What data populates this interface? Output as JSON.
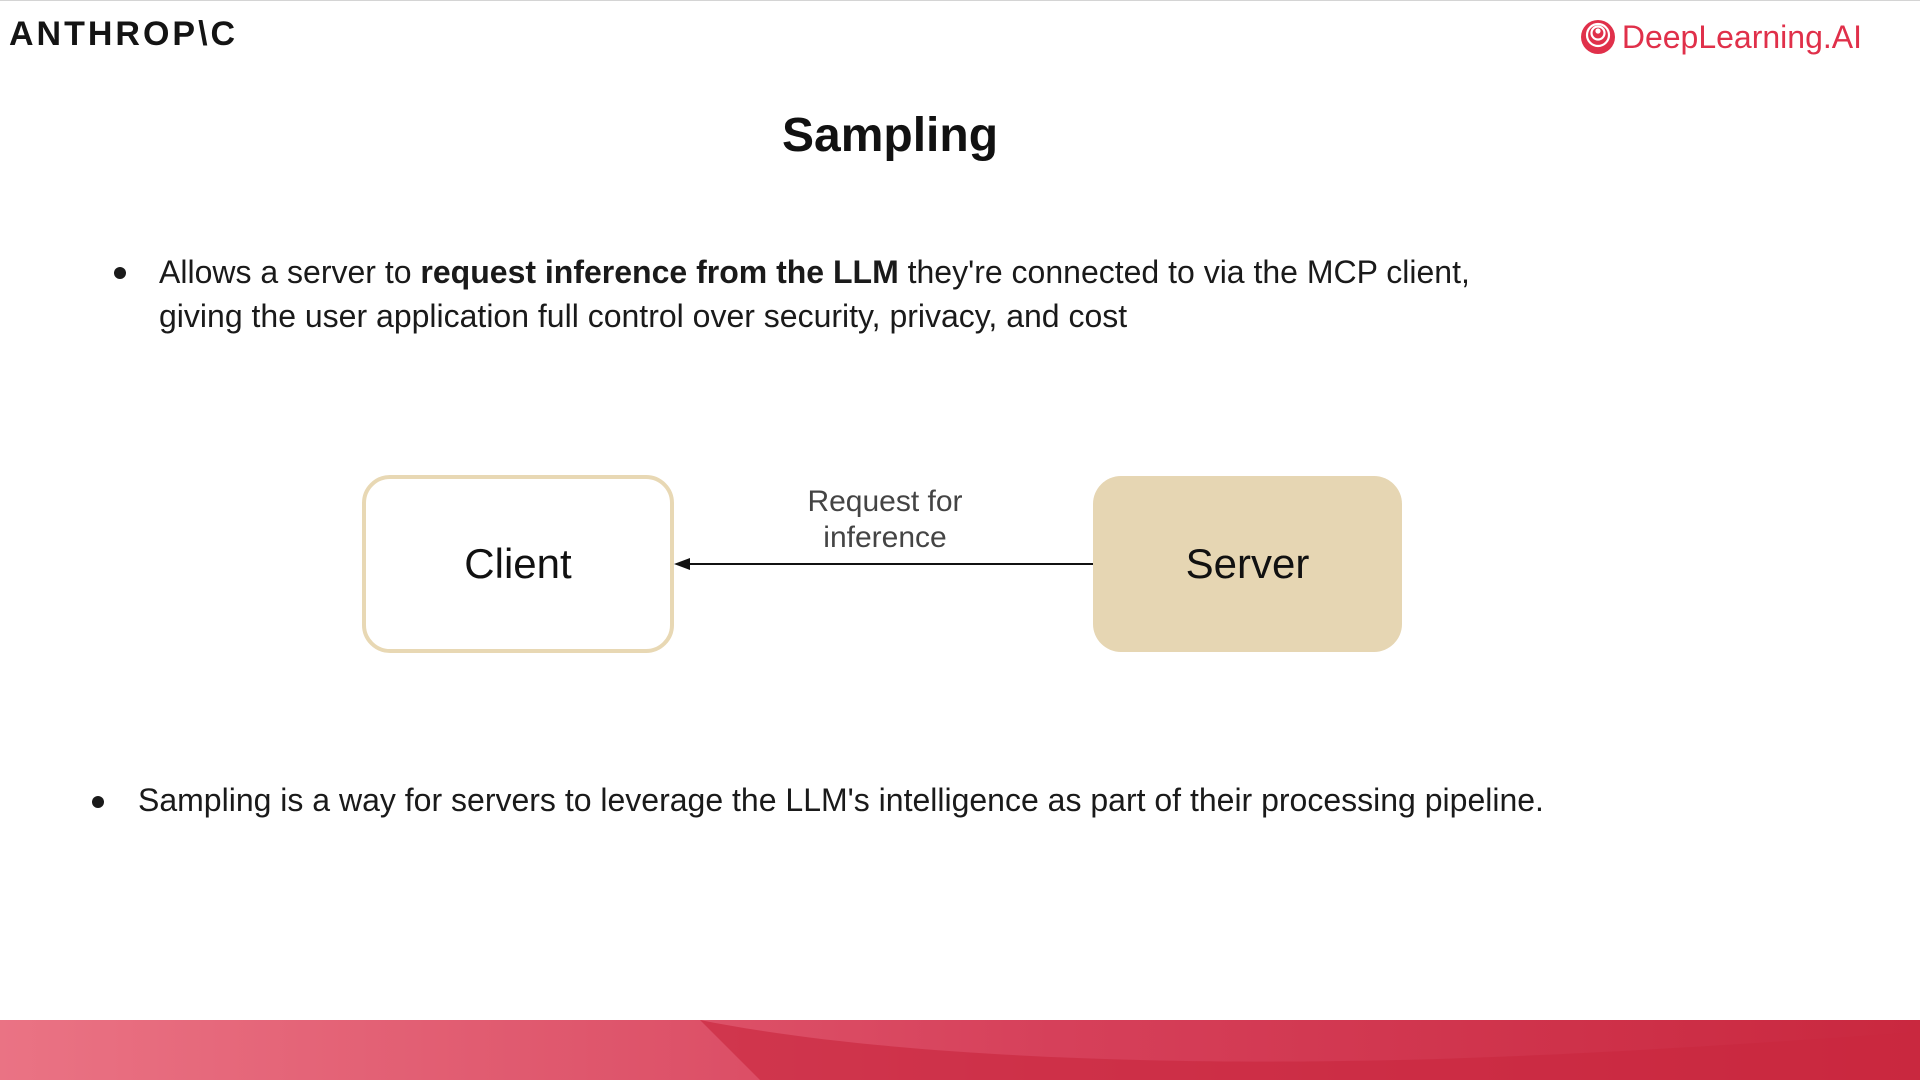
{
  "header": {
    "left_logo_text": "ANTHROP\\C",
    "right_logo_text": "DeepLearning.AI"
  },
  "slide": {
    "title": "Sampling",
    "bullet1": {
      "before": "Allows a server to ",
      "bold": "request inference from the LLM",
      "after": " they're connected to via the MCP client,",
      "line2": "giving the user application full control over security, privacy, and cost"
    },
    "bullet2": "Sampling is a way for servers to leverage the LLM's intelligence as part of their processing pipeline."
  },
  "diagram": {
    "client_label": "Client",
    "server_label": "Server",
    "edge_label_line1": "Request for",
    "edge_label_line2": "inference"
  },
  "colors": {
    "brand_red": "#e0304a",
    "box_beige": "#e6d6b3",
    "footer_left": "#e8707f",
    "footer_right": "#c9283f"
  },
  "icons": [
    "anthropic-logo",
    "deeplearning-ai-logo-icon",
    "bullet-dot-icon",
    "arrow-head-icon"
  ]
}
